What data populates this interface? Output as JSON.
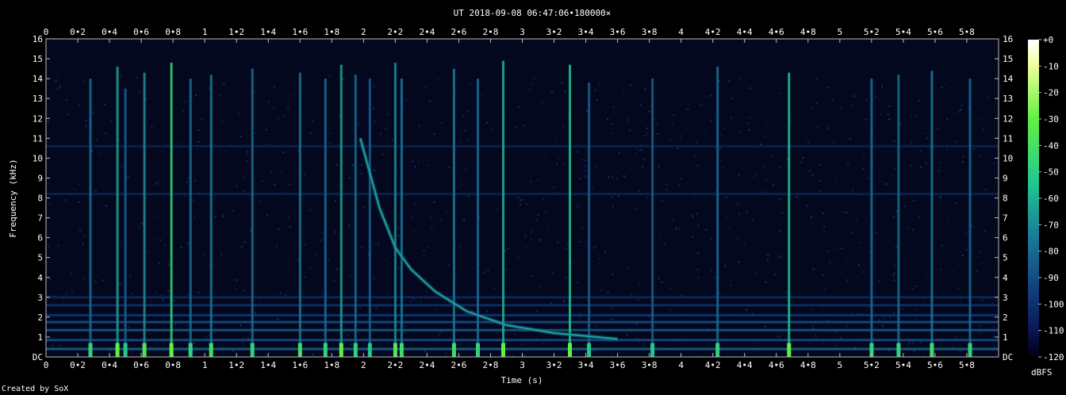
{
  "chart_data": {
    "type": "heatmap",
    "title": "UT 2018-09-08 06:47:06•180000×",
    "xlabel": "Time (s)",
    "ylabel": "Frequency (kHz)",
    "xlim": [
      0,
      6
    ],
    "ylim": [
      0,
      16
    ],
    "x_ticks": [
      "0",
      "0•2",
      "0•4",
      "0•6",
      "0•8",
      "1",
      "1•2",
      "1•4",
      "1•6",
      "1•8",
      "2",
      "2•2",
      "2•4",
      "2•6",
      "2•8",
      "3",
      "3•2",
      "3•4",
      "3•6",
      "3•8",
      "4",
      "4•2",
      "4•4",
      "4•6",
      "4•8",
      "5",
      "5•2",
      "5•4",
      "5•6",
      "5•8"
    ],
    "y_ticks": [
      "DC",
      "1",
      "2",
      "3",
      "4",
      "5",
      "6",
      "7",
      "8",
      "9",
      "10",
      "11",
      "12",
      "13",
      "14",
      "15",
      "16"
    ],
    "colorbar": {
      "label": "dBFS",
      "ticks": [
        "+0",
        "-10",
        "-20",
        "-30",
        "-40",
        "-50",
        "-60",
        "-70",
        "-80",
        "-90",
        "-100",
        "-110",
        "-120"
      ],
      "range": [
        -120,
        0
      ]
    },
    "noise_floor_dbfs": -105,
    "vertical_impulses": [
      {
        "t": 0.28,
        "top_khz": 14.0,
        "level": 0.55
      },
      {
        "t": 0.45,
        "top_khz": 14.6,
        "level": 0.7
      },
      {
        "t": 0.5,
        "top_khz": 13.5,
        "level": 0.5
      },
      {
        "t": 0.62,
        "top_khz": 14.3,
        "level": 0.65
      },
      {
        "t": 0.79,
        "top_khz": 14.8,
        "level": 0.85
      },
      {
        "t": 0.91,
        "top_khz": 14.0,
        "level": 0.55
      },
      {
        "t": 1.04,
        "top_khz": 14.2,
        "level": 0.6
      },
      {
        "t": 1.3,
        "top_khz": 14.5,
        "level": 0.55
      },
      {
        "t": 1.6,
        "top_khz": 14.3,
        "level": 0.6
      },
      {
        "t": 1.76,
        "top_khz": 14.0,
        "level": 0.55
      },
      {
        "t": 1.86,
        "top_khz": 14.7,
        "level": 0.7
      },
      {
        "t": 1.95,
        "top_khz": 14.2,
        "level": 0.55
      },
      {
        "t": 2.04,
        "top_khz": 14.0,
        "level": 0.5
      },
      {
        "t": 2.2,
        "top_khz": 14.8,
        "level": 0.65
      },
      {
        "t": 2.24,
        "top_khz": 14.0,
        "level": 0.6
      },
      {
        "t": 2.57,
        "top_khz": 14.5,
        "level": 0.6
      },
      {
        "t": 2.72,
        "top_khz": 14.0,
        "level": 0.55
      },
      {
        "t": 2.88,
        "top_khz": 14.9,
        "level": 0.75
      },
      {
        "t": 3.3,
        "top_khz": 14.7,
        "level": 0.8
      },
      {
        "t": 3.42,
        "top_khz": 13.8,
        "level": 0.5
      },
      {
        "t": 3.82,
        "top_khz": 14.0,
        "level": 0.5
      },
      {
        "t": 4.23,
        "top_khz": 14.6,
        "level": 0.55
      },
      {
        "t": 4.68,
        "top_khz": 14.3,
        "level": 0.8
      },
      {
        "t": 5.2,
        "top_khz": 14.0,
        "level": 0.55
      },
      {
        "t": 5.37,
        "top_khz": 14.2,
        "level": 0.55
      },
      {
        "t": 5.58,
        "top_khz": 14.4,
        "level": 0.6
      },
      {
        "t": 5.82,
        "top_khz": 14.0,
        "level": 0.55
      }
    ],
    "descending_tone": {
      "points": [
        [
          1.98,
          11.0
        ],
        [
          2.1,
          7.5
        ],
        [
          2.2,
          5.5
        ],
        [
          2.3,
          4.4
        ],
        [
          2.45,
          3.3
        ],
        [
          2.65,
          2.3
        ],
        [
          2.9,
          1.6
        ],
        [
          3.2,
          1.2
        ],
        [
          3.6,
          0.9
        ]
      ],
      "level": 0.55
    },
    "horizontal_bands": [
      {
        "khz": 0.4,
        "level": 0.55
      },
      {
        "khz": 0.85,
        "level": 0.45
      },
      {
        "khz": 1.35,
        "level": 0.5
      },
      {
        "khz": 1.75,
        "level": 0.45
      },
      {
        "khz": 2.1,
        "level": 0.35
      },
      {
        "khz": 2.6,
        "level": 0.3
      },
      {
        "khz": 3.0,
        "level": 0.25
      },
      {
        "khz": 8.2,
        "level": 0.2
      },
      {
        "khz": 10.6,
        "level": 0.2
      }
    ]
  },
  "footer": {
    "credit": "Created by SoX"
  }
}
